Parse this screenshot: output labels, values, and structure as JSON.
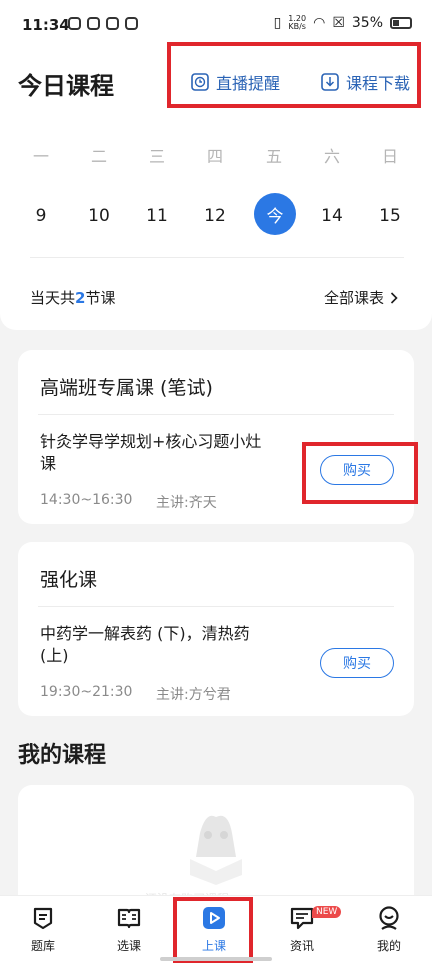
{
  "status_bar": {
    "time": "11:34",
    "net_speed_value": "1.20",
    "net_speed_unit": "KB/s",
    "battery": "35%"
  },
  "header": {
    "title": "今日课程",
    "live_reminder": "直播提醒",
    "course_download": "课程下载"
  },
  "calendar": {
    "weekdays": [
      "一",
      "二",
      "三",
      "四",
      "五",
      "六",
      "日"
    ],
    "dates": [
      "9",
      "10",
      "11",
      "12",
      "今",
      "14",
      "15"
    ],
    "today_label": "今"
  },
  "summary": {
    "prefix": "当天共",
    "count": "2",
    "suffix": "节课",
    "all_schedule": "全部课表"
  },
  "courses": [
    {
      "title": "高端班专属课 (笔试)",
      "lesson_line1": "针灸学导学规划+核心习题小灶",
      "lesson_line2": "课",
      "time": "14:30~16:30",
      "teacher": "主讲:齐天",
      "button": "购买"
    },
    {
      "title": "强化课",
      "lesson_line1": "中药学一解表药 (下)，清热药",
      "lesson_line2": "(上)",
      "time": "19:30~21:30",
      "teacher": "主讲:方兮君",
      "button": "购买"
    }
  ],
  "my_courses": {
    "title": "我的课程",
    "empty_text": "还没有购买课程"
  },
  "bottom_nav": [
    {
      "label": "题库"
    },
    {
      "label": "选课"
    },
    {
      "label": "上课"
    },
    {
      "label": "资讯",
      "badge": "NEW"
    },
    {
      "label": "我的"
    }
  ],
  "colors": {
    "accent": "#2b78e4",
    "highlight_box": "#e0262c",
    "badge": "#ec4a4a"
  }
}
